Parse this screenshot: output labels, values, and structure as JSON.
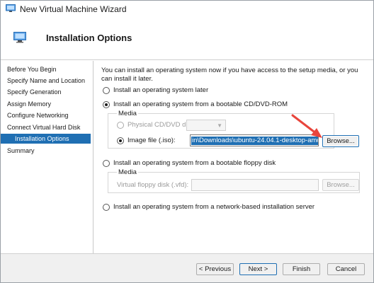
{
  "window": {
    "title": "New Virtual Machine Wizard"
  },
  "header": {
    "title": "Installation Options"
  },
  "nav": {
    "items": [
      {
        "label": "Before You Begin",
        "selected": false,
        "sub": false
      },
      {
        "label": "Specify Name and Location",
        "selected": false,
        "sub": false
      },
      {
        "label": "Specify Generation",
        "selected": false,
        "sub": false
      },
      {
        "label": "Assign Memory",
        "selected": false,
        "sub": false
      },
      {
        "label": "Configure Networking",
        "selected": false,
        "sub": false
      },
      {
        "label": "Connect Virtual Hard Disk",
        "selected": false,
        "sub": false
      },
      {
        "label": "Installation Options",
        "selected": true,
        "sub": true
      },
      {
        "label": "Summary",
        "selected": false,
        "sub": false
      }
    ]
  },
  "content": {
    "intro": "You can install an operating system now if you have access to the setup media, or you can install it later.",
    "option_later": "Install an operating system later",
    "option_cd": "Install an operating system from a bootable CD/DVD-ROM",
    "cd_media_label": "Media",
    "physical_drive_label": "Physical CD/DVD drive:",
    "image_file_label": "Image file (.iso):",
    "image_file_value": "in\\Downloads\\ubuntu-24.04.1-desktop-amd64.iso",
    "browse_label": "Browse...",
    "option_floppy": "Install an operating system from a bootable floppy disk",
    "floppy_media_label": "Media",
    "floppy_disk_label": "Virtual floppy disk (.vfd):",
    "floppy_browse_label": "Browse...",
    "option_network": "Install an operating system from a network-based installation server"
  },
  "footer": {
    "previous_label": "< Previous",
    "next_label": "Next >",
    "finish_label": "Finish",
    "cancel_label": "Cancel"
  },
  "colors": {
    "selection": "#1f6fb3",
    "annotation_arrow": "#e8453c"
  },
  "icons": [
    "hyper-v-vm-icon",
    "radio-button",
    "dropdown-arrow",
    "red-annotation-arrow"
  ]
}
